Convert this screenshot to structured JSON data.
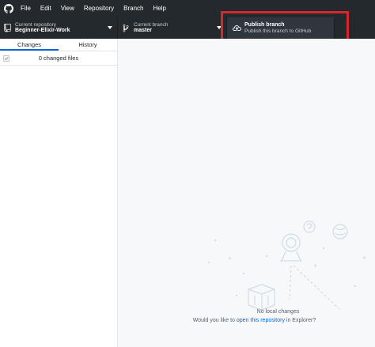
{
  "menubar": {
    "items": [
      "File",
      "Edit",
      "View",
      "Repository",
      "Branch",
      "Help"
    ]
  },
  "toolbar": {
    "repository": {
      "caption": "Current repository",
      "value": "Beginner-Elixir-Work"
    },
    "branch": {
      "caption": "Current branch",
      "value": "master"
    },
    "publish": {
      "title": "Publish branch",
      "subtitle": "Publish this branch to GitHub"
    }
  },
  "sidebar": {
    "tabs": [
      "Changes",
      "History"
    ],
    "active_tab": "Changes",
    "changed_files": "0 changed files"
  },
  "main": {
    "empty_title": "No local changes",
    "empty_prefix": "Would you like to ",
    "empty_link": "open this repository",
    "empty_suffix": " in Explorer?"
  },
  "colors": {
    "toolbar_bg": "#24292e",
    "publish_bg": "#2f363d",
    "highlight": "#d7262e",
    "link": "#0366d6"
  }
}
